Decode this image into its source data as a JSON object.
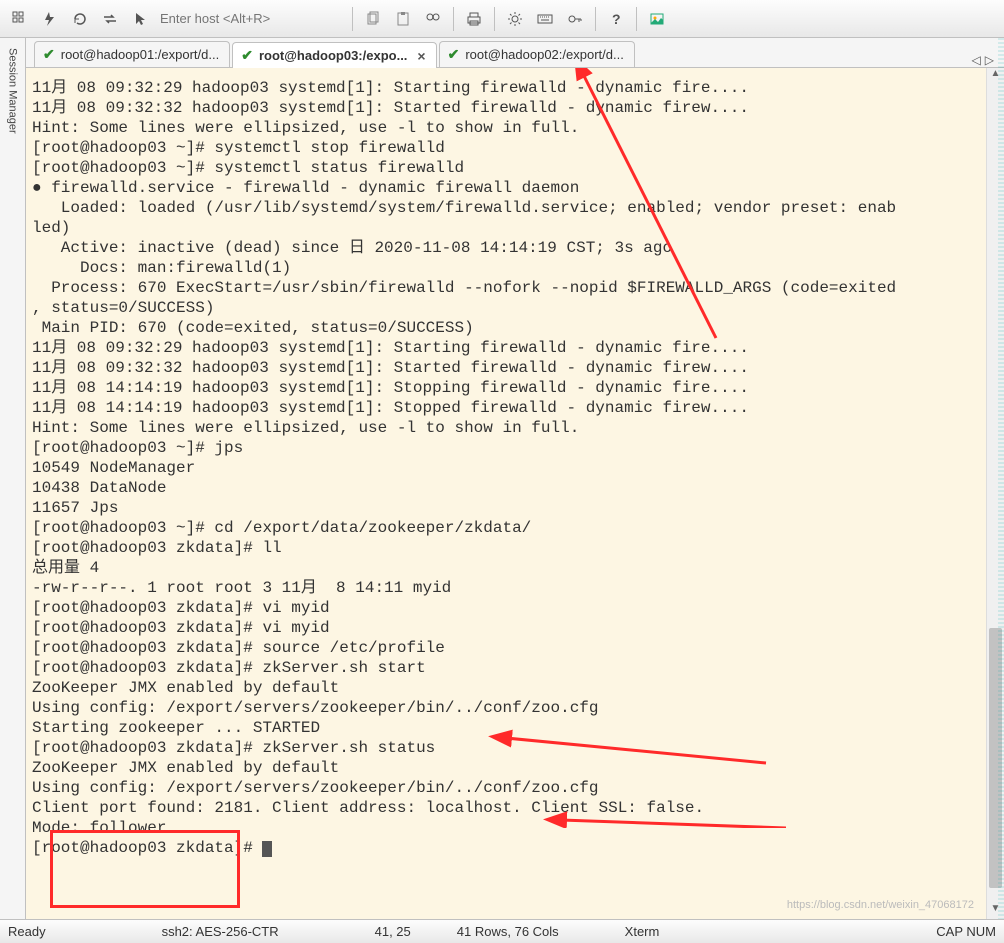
{
  "toolbar": {
    "host_placeholder": "Enter host <Alt+R>",
    "icons": [
      "grid-icon",
      "bolt-icon",
      "refresh-icon",
      "loop-icon",
      "pointer-icon"
    ],
    "icons2": [
      "copy-icon",
      "paste-icon",
      "binocular-icon"
    ],
    "icons3": [
      "print-icon"
    ],
    "icons4": [
      "gear-icon",
      "keyboard-icon",
      "key-icon"
    ],
    "icons5": [
      "help-icon"
    ],
    "icons6": [
      "image-icon"
    ]
  },
  "sidebar": {
    "label": "Session Manager"
  },
  "tabs": [
    {
      "label": "root@hadoop01:/export/d...",
      "active": false
    },
    {
      "label": "root@hadoop03:/expo...",
      "active": true
    },
    {
      "label": "root@hadoop02:/export/d...",
      "active": false
    }
  ],
  "terminal": {
    "lines": [
      "11月 08 09:32:29 hadoop03 systemd[1]: Starting firewalld - dynamic fire....",
      "11月 08 09:32:32 hadoop03 systemd[1]: Started firewalld - dynamic firew....",
      "Hint: Some lines were ellipsized, use -l to show in full.",
      "[root@hadoop03 ~]# systemctl stop firewalld",
      "[root@hadoop03 ~]# systemctl status firewalld",
      "● firewalld.service - firewalld - dynamic firewall daemon",
      "   Loaded: loaded (/usr/lib/systemd/system/firewalld.service; enabled; vendor preset: enabled)",
      "   Active: inactive (dead) since 日 2020-11-08 14:14:19 CST; 3s ago",
      "     Docs: man:firewalld(1)",
      "  Process: 670 ExecStart=/usr/sbin/firewalld --nofork --nopid $FIREWALLD_ARGS (code=exited, status=0/SUCCESS)",
      " Main PID: 670 (code=exited, status=0/SUCCESS)",
      "",
      "11月 08 09:32:29 hadoop03 systemd[1]: Starting firewalld - dynamic fire....",
      "11月 08 09:32:32 hadoop03 systemd[1]: Started firewalld - dynamic firew....",
      "11月 08 14:14:19 hadoop03 systemd[1]: Stopping firewalld - dynamic fire....",
      "11月 08 14:14:19 hadoop03 systemd[1]: Stopped firewalld - dynamic firew....",
      "Hint: Some lines were ellipsized, use -l to show in full.",
      "[root@hadoop03 ~]# jps",
      "10549 NodeManager",
      "10438 DataNode",
      "11657 Jps",
      "[root@hadoop03 ~]# cd /export/data/zookeeper/zkdata/",
      "[root@hadoop03 zkdata]# ll",
      "总用量 4",
      "-rw-r--r--. 1 root root 3 11月  8 14:11 myid",
      "[root@hadoop03 zkdata]# vi myid",
      "[root@hadoop03 zkdata]# vi myid",
      "[root@hadoop03 zkdata]# source /etc/profile",
      "[root@hadoop03 zkdata]# zkServer.sh start",
      "ZooKeeper JMX enabled by default",
      "Using config: /export/servers/zookeeper/bin/../conf/zoo.cfg",
      "Starting zookeeper ... STARTED",
      "[root@hadoop03 zkdata]# zkServer.sh status",
      "ZooKeeper JMX enabled by default",
      "Using config: /export/servers/zookeeper/bin/../conf/zoo.cfg",
      "Client port found: 2181. Client address: localhost. Client SSL: false.",
      "Mode: follower",
      "[root@hadoop03 zkdata]# "
    ]
  },
  "status": {
    "ready": "Ready",
    "conn": "ssh2: AES-256-CTR",
    "pos": "41, 25",
    "size": "41 Rows, 76 Cols",
    "term": "Xterm",
    "caps": "CAP NUM"
  },
  "watermark": "https://blog.csdn.net/weixin_47068172"
}
